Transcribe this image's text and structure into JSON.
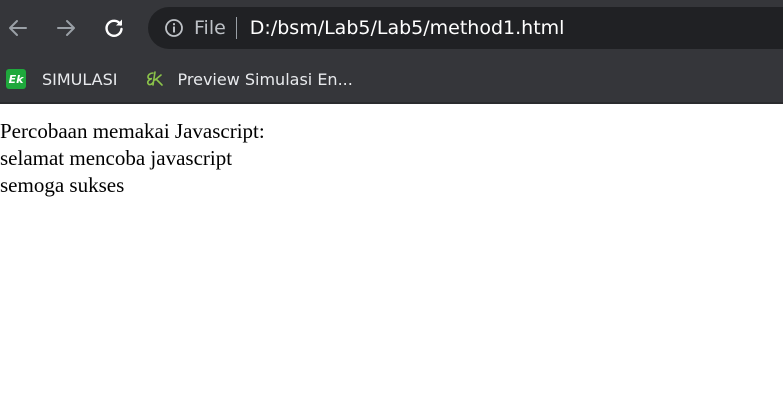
{
  "toolbar": {
    "back_icon": "arrow-left-icon",
    "forward_icon": "arrow-right-icon",
    "reload_icon": "reload-icon",
    "info_icon": "info-circle-icon",
    "scheme_label": "File",
    "url": "D:/bsm/Lab5/Lab5/method1.html"
  },
  "bookmarks": [
    {
      "label": "SIMULASI",
      "favicon_text": "Ek",
      "favicon_color": "#1fa83c"
    },
    {
      "label": "Preview Simulasi En...",
      "favicon_icon": "ek-script-logo-icon"
    }
  ],
  "page": {
    "lines": [
      "Percobaan memakai Javascript:",
      "selamat mencoba javascript",
      "semoga sukses"
    ]
  },
  "colors": {
    "chrome_bg": "#35363a",
    "omnibox_bg": "#202124",
    "page_bg": "#ffffff"
  }
}
